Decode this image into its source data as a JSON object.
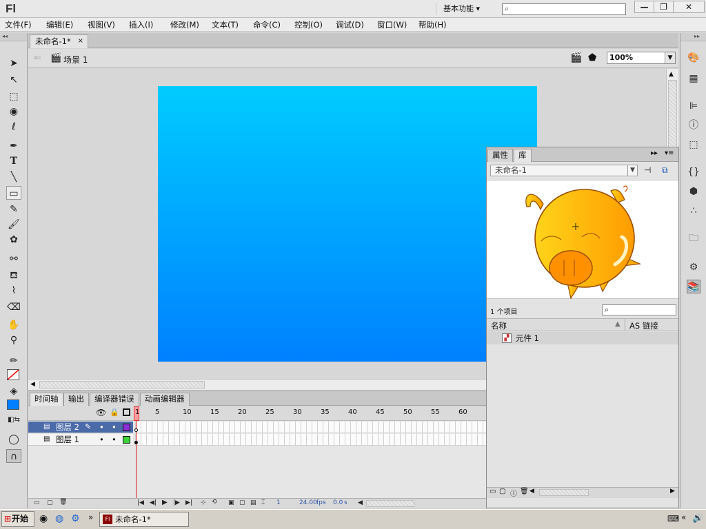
{
  "app": {
    "logo": "Fl",
    "workspace": "基本功能",
    "workspace_arrow": "▾",
    "search_placeholder": ""
  },
  "window_buttons": {
    "minimize": "—",
    "maximize": "❐",
    "close": "✕"
  },
  "menu": [
    "文件(F)",
    "编辑(E)",
    "视图(V)",
    "插入(I)",
    "修改(M)",
    "文本(T)",
    "命令(C)",
    "控制(O)",
    "调试(D)",
    "窗口(W)",
    "帮助(H)"
  ],
  "document": {
    "tab_title": "未命名-1*",
    "tab_close": "×",
    "scene": "场景 1",
    "zoom": "100%"
  },
  "timeline": {
    "tabs": [
      "时间轴",
      "输出",
      "编译器错误",
      "动画编辑器"
    ],
    "frame_ruler": [
      "1",
      "5",
      "10",
      "15",
      "20",
      "25",
      "30",
      "35",
      "40",
      "45",
      "50",
      "55",
      "60"
    ],
    "layers": [
      {
        "name": "图层 2",
        "color": "#8b2fd6",
        "selected": true
      },
      {
        "name": "图层 1",
        "color": "#3ed23e",
        "selected": false
      }
    ],
    "current_frame": "1",
    "fps": "24.00",
    "fps_unit": "fps",
    "time": "0.0",
    "time_unit": "s"
  },
  "library": {
    "tabs": [
      "属性",
      "库"
    ],
    "document_select": "未命名-1",
    "item_count": "1 个项目",
    "col_name": "名称",
    "col_linkage": "AS 链接",
    "items": [
      {
        "name": "元件 1"
      }
    ]
  },
  "taskbar": {
    "start": "开始",
    "task": "未命名-1*",
    "tray_chevron": "«",
    "quicklaunch_more": "»"
  },
  "colors": {
    "stage_top": "#00ccff",
    "stage_bottom": "#0080ff",
    "selected_layer": "#4a6aa8",
    "pig_body": "#ffc400",
    "pig_snout": "#ff9900"
  }
}
